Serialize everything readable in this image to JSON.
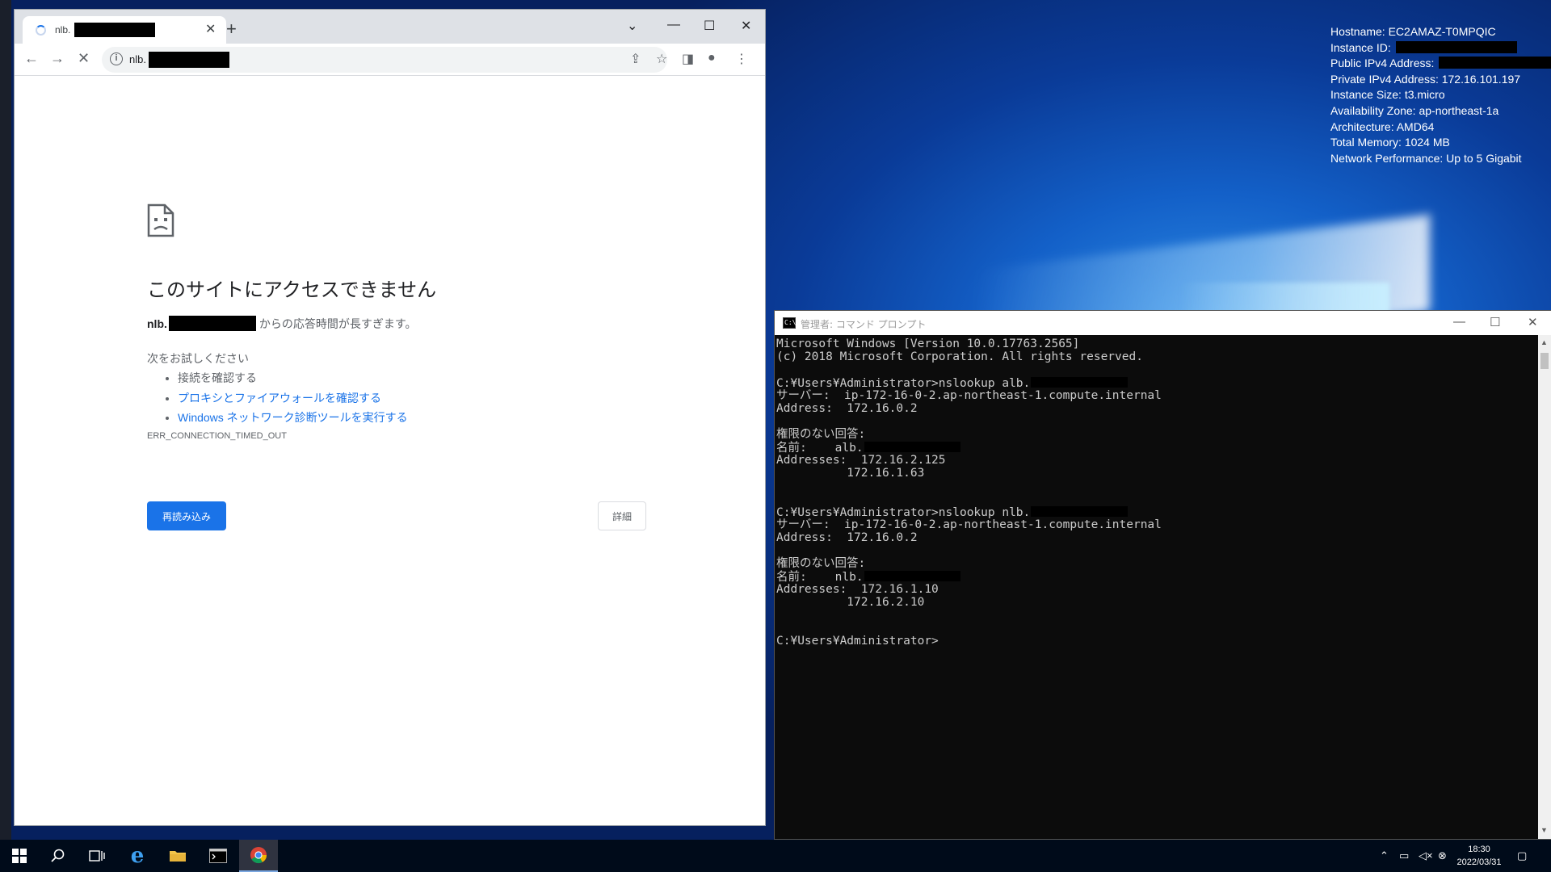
{
  "bginfo": [
    {
      "label": "Hostname:",
      "value": "EC2AMAZ-T0MPQIC",
      "redacted": false
    },
    {
      "label": "Instance ID:",
      "value": "",
      "redacted": true
    },
    {
      "label": "Public IPv4 Address:",
      "value": "",
      "redacted": true
    },
    {
      "label": "Private IPv4 Address:",
      "value": "172.16.101.197",
      "redacted": false
    },
    {
      "label": "Instance Size:",
      "value": "t3.micro",
      "redacted": false
    },
    {
      "label": "Availability Zone:",
      "value": "ap-northeast-1a",
      "redacted": false
    },
    {
      "label": "Architecture:",
      "value": "AMD64",
      "redacted": false
    },
    {
      "label": "Total Memory:",
      "value": "1024 MB",
      "redacted": false
    },
    {
      "label": "Network Performance:",
      "value": "Up to 5 Gigabit",
      "redacted": false
    }
  ],
  "chrome": {
    "tab_title": "nlb.",
    "address": "nlb.",
    "error": {
      "title": "このサイトにアクセスできません",
      "host_prefix": "nlb.",
      "message": "からの応答時間が長すぎます。",
      "try_heading": "次をお試しください",
      "suggestions": [
        {
          "text": "接続を確認する",
          "link": false
        },
        {
          "text": "プロキシとファイアウォールを確認する",
          "link": true
        },
        {
          "text": "Windows ネットワーク診断ツールを実行する",
          "link": true
        }
      ],
      "code": "ERR_CONNECTION_TIMED_OUT",
      "reload_label": "再読み込み",
      "details_label": "詳細"
    }
  },
  "cmd": {
    "title": "管理者: コマンド プロンプト",
    "lines": [
      {
        "text": "Microsoft Windows [Version 10.0.17763.2565]"
      },
      {
        "text": "(c) 2018 Microsoft Corporation. All rights reserved."
      },
      {
        "text": ""
      },
      {
        "text": "C:¥Users¥Administrator>nslookup alb.",
        "redact": 14
      },
      {
        "text": "サーバー:  ip-172-16-0-2.ap-northeast-1.compute.internal"
      },
      {
        "text": "Address:  172.16.0.2"
      },
      {
        "text": ""
      },
      {
        "text": "権限のない回答:"
      },
      {
        "text": "名前:    alb.",
        "redact": 14
      },
      {
        "text": "Addresses:  172.16.2.125"
      },
      {
        "text": "          172.16.1.63"
      },
      {
        "text": ""
      },
      {
        "text": ""
      },
      {
        "text": "C:¥Users¥Administrator>nslookup nlb.",
        "redact": 14
      },
      {
        "text": "サーバー:  ip-172-16-0-2.ap-northeast-1.compute.internal"
      },
      {
        "text": "Address:  172.16.0.2"
      },
      {
        "text": ""
      },
      {
        "text": "権限のない回答:"
      },
      {
        "text": "名前:    nlb.",
        "redact": 14
      },
      {
        "text": "Addresses:  172.16.1.10"
      },
      {
        "text": "          172.16.2.10"
      },
      {
        "text": ""
      },
      {
        "text": ""
      },
      {
        "text": "C:¥Users¥Administrator>"
      }
    ]
  },
  "taskbar": {
    "time": "18:30",
    "date": "2022/03/31",
    "apps": [
      {
        "name": "start",
        "icon": "windows-logo-icon"
      },
      {
        "name": "search",
        "icon": "search-icon"
      },
      {
        "name": "task-view",
        "icon": "task-view-icon"
      },
      {
        "name": "internet-explorer",
        "icon": "ie-icon"
      },
      {
        "name": "file-explorer",
        "icon": "folder-icon"
      },
      {
        "name": "command-prompt",
        "icon": "cmd-icon"
      },
      {
        "name": "chrome",
        "icon": "chrome-icon"
      }
    ]
  }
}
